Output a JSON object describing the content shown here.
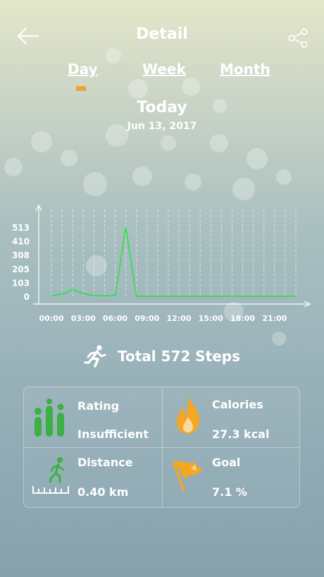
{
  "header": {
    "title": "Detail",
    "back_icon": "arrow-left-icon",
    "share_icon": "share-icon"
  },
  "tabs": [
    {
      "label": "Day",
      "selected": true
    },
    {
      "label": "Week",
      "selected": false
    },
    {
      "label": "Month",
      "selected": false
    }
  ],
  "date": {
    "title": "Today",
    "subtitle": "Jun 13, 2017"
  },
  "chart_data": {
    "type": "line",
    "x": [
      "00:00",
      "01:00",
      "02:00",
      "03:00",
      "04:00",
      "05:00",
      "06:00",
      "07:00",
      "08:00",
      "09:00",
      "10:00",
      "11:00",
      "12:00",
      "13:00",
      "14:00",
      "15:00",
      "16:00",
      "17:00",
      "18:00",
      "19:00",
      "20:00",
      "21:00",
      "22:00",
      "23:00"
    ],
    "series": [
      {
        "values": [
          10,
          20,
          55,
          25,
          10,
          10,
          10,
          516,
          5,
          5,
          5,
          5,
          5,
          5,
          5,
          5,
          5,
          5,
          5,
          5,
          5,
          5,
          5,
          5
        ]
      }
    ],
    "y_ticks": [
      "0",
      "103",
      "205",
      "308",
      "410",
      "513"
    ],
    "x_ticks": [
      "00:00",
      "03:00",
      "06:00",
      "09:00",
      "12:00",
      "15:00",
      "18:00",
      "21:00"
    ],
    "ylim": [
      0,
      513
    ],
    "grid": "vertical dashed",
    "line_color": "#3ddc5a"
  },
  "summary": {
    "icon": "running-person-icon",
    "label": "Total 572 Steps"
  },
  "stats": {
    "rating": {
      "label": "Rating",
      "value": "Insufficient",
      "icon": "bar-rating-icon",
      "color": "#3cb043"
    },
    "calories": {
      "label": "Calories",
      "value": "27.3 kcal",
      "icon": "flame-icon",
      "color": "#f5a623"
    },
    "distance": {
      "label": "Distance",
      "value": "0.40 km",
      "icon": "walking-ruler-icon",
      "color": "#3cb043"
    },
    "goal": {
      "label": "Goal",
      "value": "7.1 %",
      "icon": "flag-icon",
      "color": "#f5a623"
    }
  }
}
